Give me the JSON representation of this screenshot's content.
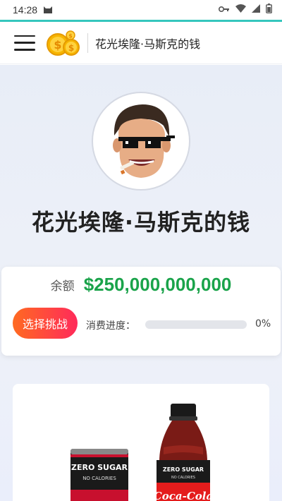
{
  "status_bar": {
    "time": "14:28",
    "icons": [
      "cat-icon",
      "key-icon",
      "wifi-icon",
      "signal-icon",
      "battery-icon"
    ]
  },
  "app_bar": {
    "title": "花光埃隆·马斯克的钱",
    "logo": "coin-stack-icon"
  },
  "profile": {
    "name": "花光埃隆·马斯克的钱"
  },
  "balance": {
    "label": "余额",
    "value": "$250,000,000,000",
    "value_color": "#1aa34a"
  },
  "challenge": {
    "button_label": "选择挑战",
    "progress_label": "消费进度：",
    "progress_percent_text": "0%",
    "progress_fraction": 0
  },
  "products": [
    {
      "name": "zero-sugar-can",
      "texts": [
        "ZERO SUGAR",
        "NO CALORIES"
      ]
    },
    {
      "name": "coca-cola-bottle",
      "texts": [
        "ZERO SUGAR",
        "NO CALORIES",
        "Coca-Cola"
      ]
    }
  ],
  "colors": {
    "accent_teal": "#35c6bd",
    "button_gradient_start": "#ff6a21",
    "button_gradient_end": "#ff2a5a"
  }
}
